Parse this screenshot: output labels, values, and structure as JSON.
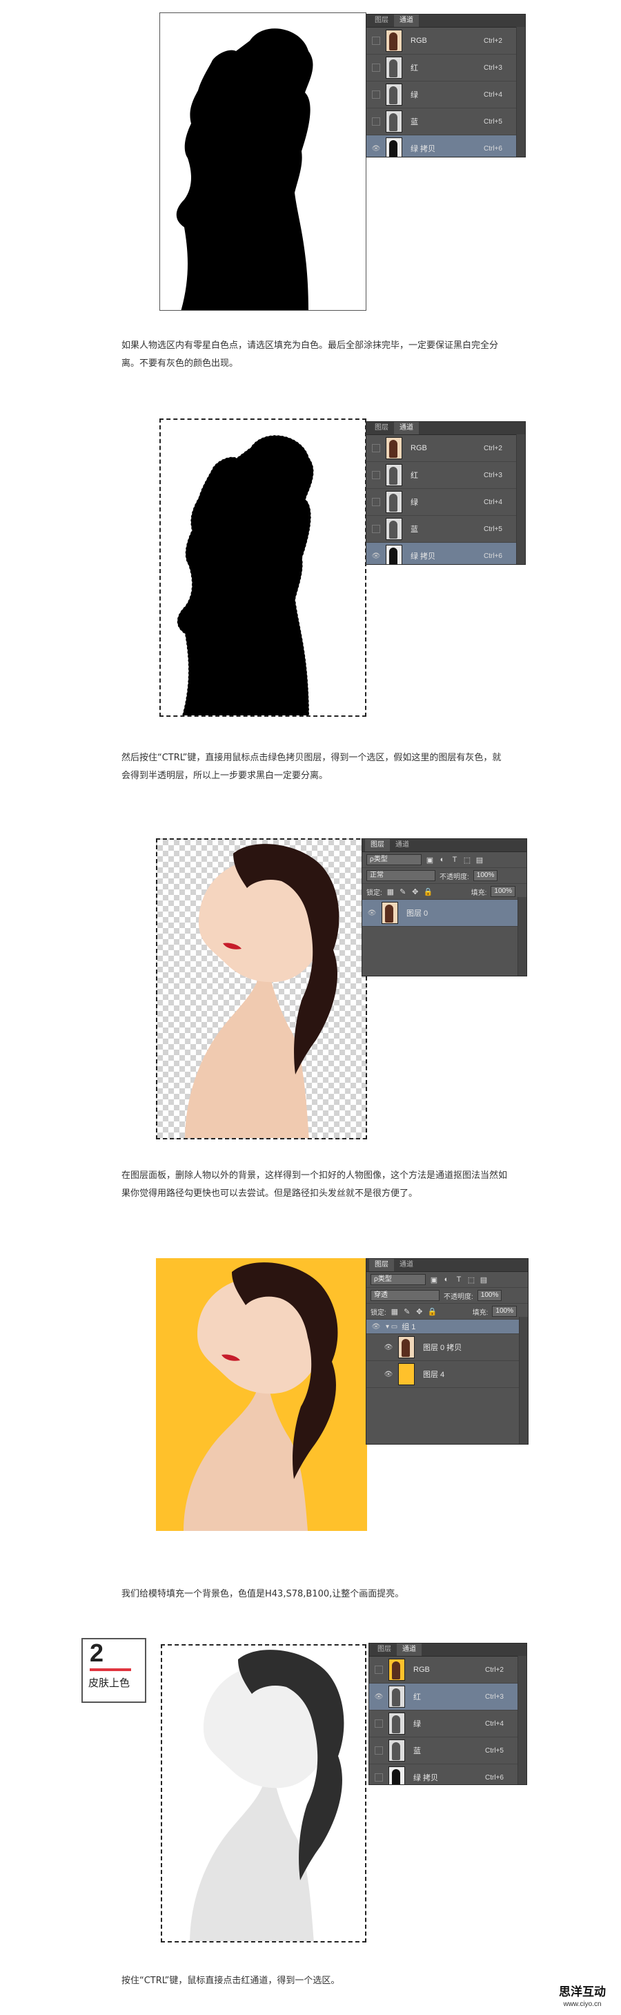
{
  "channels_panel": {
    "tab_layers": "图层",
    "tab_channels": "通道",
    "rows": [
      {
        "name": "RGB",
        "shortcut": "Ctrl+2"
      },
      {
        "name": "红",
        "shortcut": "Ctrl+3"
      },
      {
        "name": "绿",
        "shortcut": "Ctrl+4"
      },
      {
        "name": "蓝",
        "shortcut": "Ctrl+5"
      },
      {
        "name": "绿 拷贝",
        "shortcut": "Ctrl+6"
      }
    ]
  },
  "captions": {
    "c1": "如果人物选区内有零星白色点，请选区填充为白色。最后全部涂抹完毕，一定要保证黑白完全分离。不要有灰色的颜色出现。",
    "c2": "然后按住“CTRL”键，直接用鼠标点击绿色拷贝图层，得到一个选区，假如这里的图层有灰色，就会得到半透明层，所以上一步要求黑白一定要分离。",
    "c3": "在图层面板，删除人物以外的背景，这样得到一个扣好的人物图像，这个方法是通道抠图法当然如果你觉得用路径勾更快也可以去尝试。但是路径扣头发丝就不是很方便了。",
    "c4": "我们给模特填充一个背景色，色值是H43,S78,B100,让整个画面提亮。",
    "c5": "按住“CTRL”键，鼠标直接点击红通道，得到一个选区。"
  },
  "layers_panel_a": {
    "filter": "ρ类型",
    "blend": "正常",
    "opacity_label": "不透明度:",
    "opacity": "100%",
    "lock_label": "锁定:",
    "fill_label": "填充:",
    "fill": "100%",
    "layers": [
      {
        "name": "图层 0"
      }
    ]
  },
  "layers_panel_b": {
    "filter": "ρ类型",
    "blend": "穿透",
    "opacity_label": "不透明度:",
    "opacity": "100%",
    "lock_label": "锁定:",
    "fill_label": "填充:",
    "fill": "100%",
    "layers": [
      {
        "name": "组 1"
      },
      {
        "name": "图层 0 拷贝"
      },
      {
        "name": "图层 4"
      }
    ]
  },
  "step_badge": {
    "number": "2",
    "label": "皮肤上色"
  },
  "watermark": {
    "name": "思洋互动",
    "url": "www.ciyo.cn"
  },
  "colors": {
    "accent_red": "#e0353f",
    "bg_yellow": "#ffc12b",
    "panel_gray": "#535353",
    "selected_row": "#6f7f95"
  }
}
